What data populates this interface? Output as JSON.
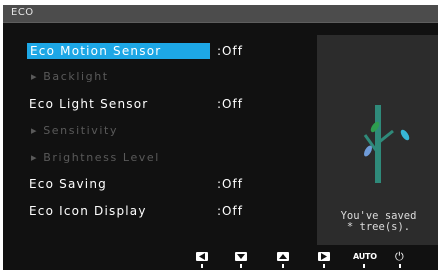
{
  "osd": {
    "title": "ECO",
    "items": [
      {
        "label": "Eco Motion Sensor",
        "value": ":Off"
      },
      {
        "label": "▸ Backlight",
        "value": ""
      },
      {
        "label": "Eco Light Sensor",
        "value": ":Off"
      },
      {
        "label": "▸ Sensitivity",
        "value": ""
      },
      {
        "label": "▸ Brightness Level",
        "value": ""
      },
      {
        "label": "Eco Saving",
        "value": ":Off"
      },
      {
        "label": "Eco Icon Display",
        "value": ":Off"
      }
    ],
    "saved_line1": "You've saved",
    "saved_line2": "* tree(s).",
    "footer": {
      "auto_label": "AUTO",
      "power_symbol": "⏻"
    },
    "colors": {
      "highlight": "#1da7e6",
      "leaf_green": "#2e9e4f",
      "leaf_teal": "#37b6d6",
      "leaf_blue": "#6f9cd9",
      "trunk": "#2f8a7a"
    }
  }
}
